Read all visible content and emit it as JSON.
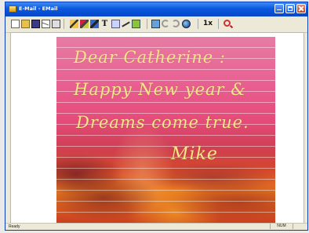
{
  "window": {
    "title": "E-Mail - EMail"
  },
  "toolbar": {
    "text_tool_label": "T",
    "zoom_label": "1x"
  },
  "letter": {
    "line1": "Dear Catherine :",
    "line2": "Happy New year &",
    "line3": "Dreams come true.",
    "signature": "Mike"
  },
  "statusbar": {
    "status": "Ready",
    "position": "NUM"
  },
  "colors": {
    "titlebar": "#0a58e0",
    "handwriting": "#f4e58a",
    "sky_pink": "#e85f91",
    "sunset_orange": "#e7781f"
  }
}
